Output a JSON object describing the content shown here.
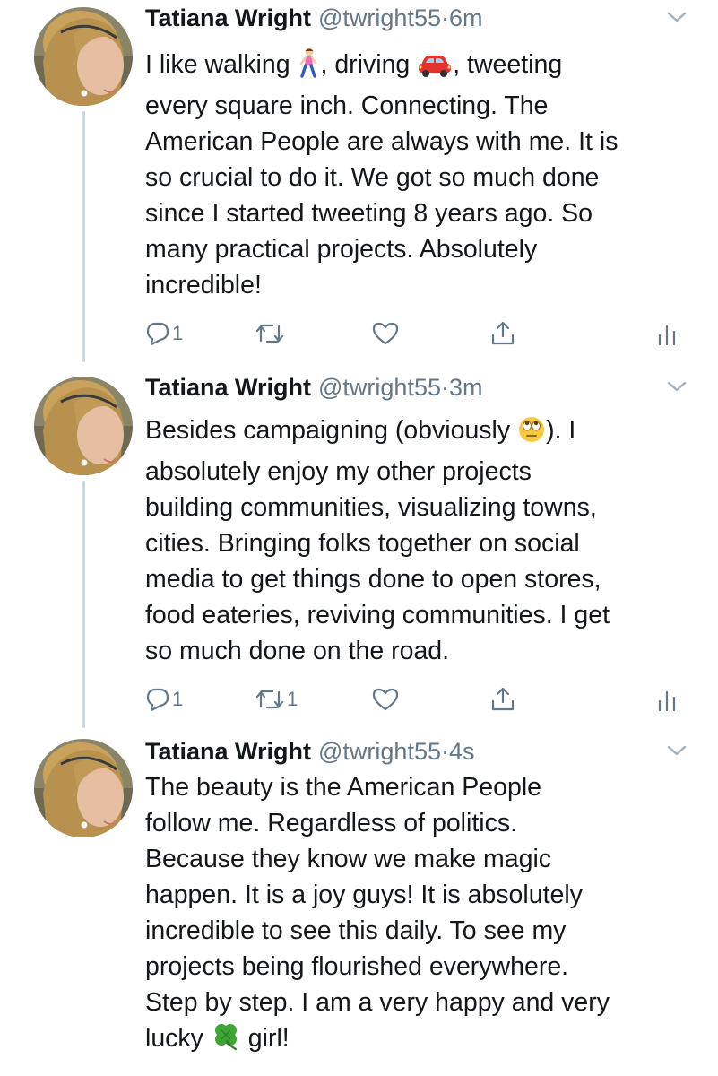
{
  "tweets": [
    {
      "name": "Tatiana Wright",
      "handle": "@twright55",
      "separator": "·",
      "time": "6m",
      "text_parts": [
        "I like walking ",
        ", driving ",
        ", tweeting\nevery square inch. Connecting. The\nAmerican People are always with me. It is\nso crucial to do it. We got so much done\nsince I started tweeting 8 years ago. So\nmany practical projects. Absolutely\nincredible!"
      ],
      "emojis": [
        "woman-walking-emoji",
        "red-car-emoji"
      ],
      "reply_count": "1",
      "retweet_count": "",
      "like_count": ""
    },
    {
      "name": "Tatiana Wright",
      "handle": "@twright55",
      "separator": "·",
      "time": "3m",
      "text_parts": [
        "Besides campaigning (obviously ",
        "). I\nabsolutely enjoy my other projects\nbuilding communities, visualizing towns,\ncities. Bringing folks together on social\nmedia to get things done to open stores,\nfood eateries, reviving communities. I get\nso much done on the road."
      ],
      "emojis": [
        "eye-roll-emoji"
      ],
      "reply_count": "1",
      "retweet_count": "1",
      "like_count": ""
    },
    {
      "name": "Tatiana Wright",
      "handle": "@twright55",
      "separator": "·",
      "time": "4s",
      "text_parts": [
        "The beauty is the American People\nfollow me. Regardless of politics.\nBecause they know we make magic\nhappen. It is a joy guys! It is absolutely\nincredible to see this daily. To see my\nprojects being flourished everywhere.\nStep by step. I am a very happy and very\nlucky ",
        " girl!"
      ],
      "emojis": [
        "four-leaf-clover-emoji"
      ],
      "reply_count": "",
      "retweet_count": "",
      "like_count": ""
    }
  ],
  "colors": {
    "text": "#14171a",
    "secondary": "#657786",
    "thread_line": "#ccd6dd"
  }
}
